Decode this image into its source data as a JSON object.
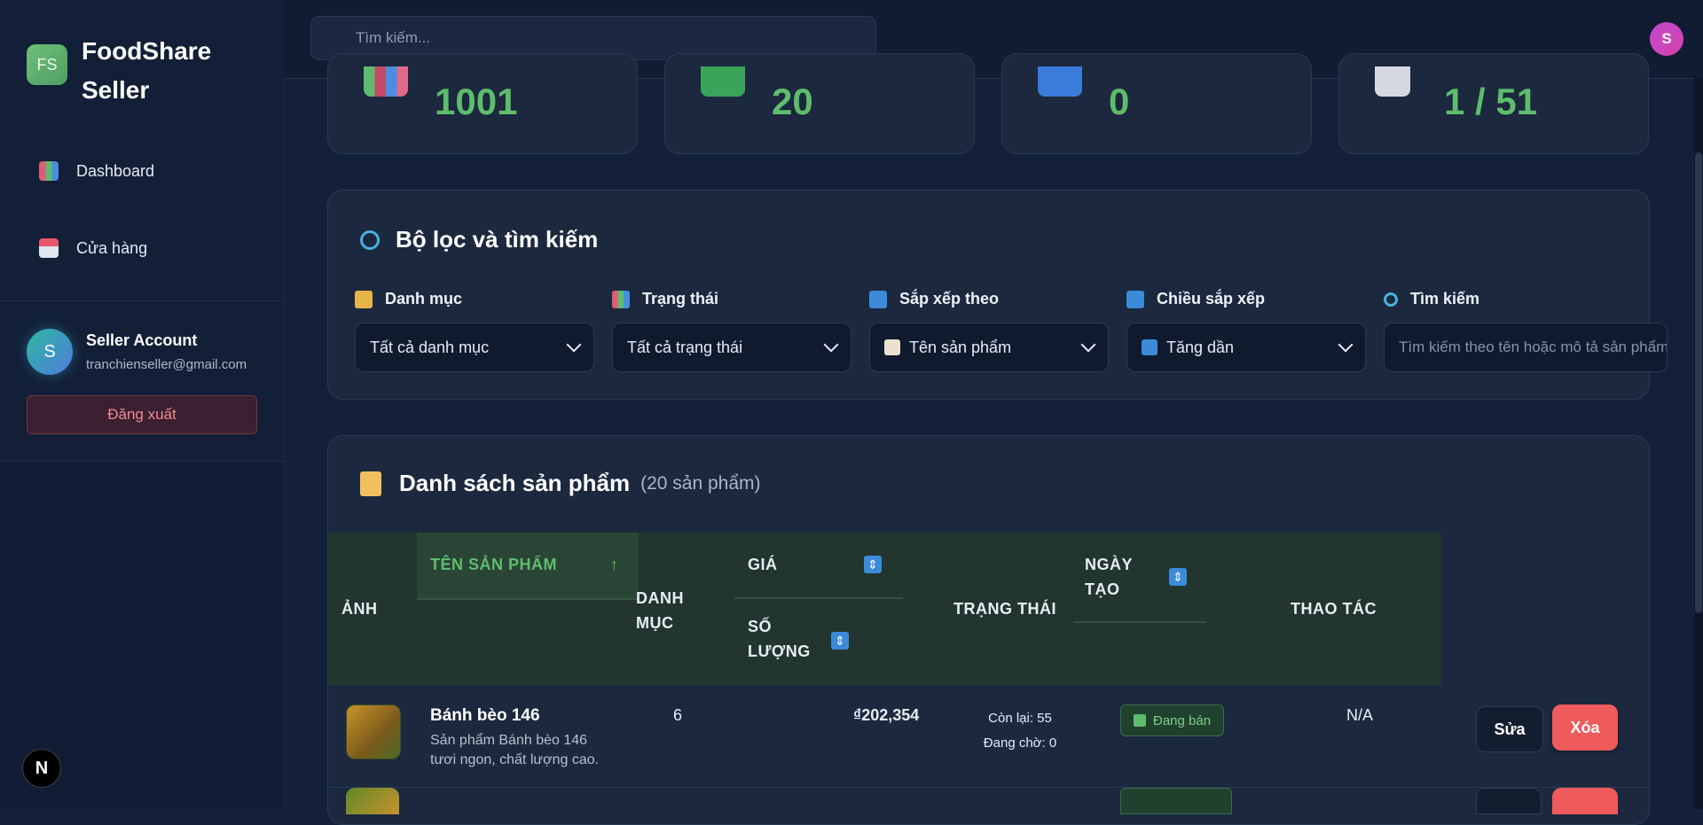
{
  "brand": {
    "logo": "FS",
    "name": "FoodShare Seller"
  },
  "nav": [
    {
      "label": "Dashboard",
      "icon": "bar-chart-icon"
    },
    {
      "label": "Cửa hàng",
      "icon": "store-icon"
    }
  ],
  "account": {
    "initial": "S",
    "name": "Seller Account",
    "email": "tranchienseller@gmail.com",
    "logout_label": "Đăng xuất"
  },
  "header": {
    "search_placeholder": "Tìm kiếm...",
    "avatar_initial": "S"
  },
  "stats": [
    {
      "value": "1001",
      "icon": "books-icon",
      "color": "#c44a6a"
    },
    {
      "value": "20",
      "icon": "check-icon",
      "color": "#3aa55a"
    },
    {
      "value": "0",
      "icon": "pause-icon",
      "color": "#3b7bd9"
    },
    {
      "value": "1 / 51",
      "icon": "page-icon",
      "color": "#d6d8e0"
    }
  ],
  "filter": {
    "title": "Bộ lọc và tìm kiếm",
    "category": {
      "label": "Danh mục",
      "value": "Tất cả danh mục"
    },
    "status": {
      "label": "Trạng thái",
      "value": "Tất cả trạng thái"
    },
    "sort_by": {
      "label": "Sắp xếp theo",
      "value": "Tên sản phẩm"
    },
    "sort_dir": {
      "label": "Chiều sắp xếp",
      "value": "Tăng dần"
    },
    "search": {
      "label": "Tìm kiếm",
      "placeholder": "Tìm kiếm theo tên hoặc mô tả sản phẩm..."
    }
  },
  "products": {
    "title": "Danh sách sản phẩm",
    "count": "(20 sản phẩm)",
    "columns": {
      "image": "ẢNH",
      "name": "TÊN SẢN PHẨM",
      "category": "DANH MỤC",
      "price": "GIÁ",
      "quantity": "SỐ LƯỢNG",
      "status": "TRẠNG THÁI",
      "created": "NGÀY TẠO",
      "actions": "THAO TÁC"
    },
    "rows": [
      {
        "name": "Bánh bèo 146",
        "description": "Sản phẩm Bánh bèo 146 tươi ngon, chất lượng cao.",
        "category": "6",
        "price": "₫202,354",
        "remaining": "Còn lại: 55",
        "pending": "Đang chờ: 0",
        "status": "Đang bán",
        "created": "N/A",
        "edit_label": "Sửa",
        "delete_label": "Xóa"
      }
    ]
  }
}
